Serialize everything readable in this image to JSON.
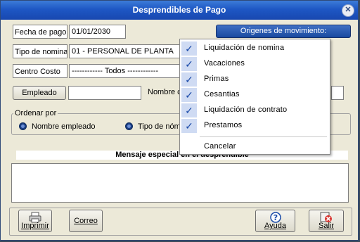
{
  "window": {
    "title": "Desprendibles de Pago",
    "close_glyph": "✕"
  },
  "form": {
    "fecha_label": "Fecha de pago",
    "fecha_value": "01/01/2030",
    "tipo_label": "Tipo de nomina",
    "tipo_value": "01 - PERSONAL DE PLANTA",
    "centro_label": "Centro Costo",
    "centro_value": "------------ Todos ------------",
    "empleado_button": "Empleado",
    "empleado_value": "",
    "nombre_label": "Nombre c",
    "origenes_button": "Origenes de movimiento:"
  },
  "ordenar": {
    "legend": "Ordenar por",
    "options": [
      "Nombre empleado",
      "Tipo de nóm"
    ]
  },
  "mensaje": {
    "label": "Mensaje especial en el desprendible",
    "value": ""
  },
  "footer": {
    "imprimir": "Imprimir",
    "correo": "Correo",
    "ayuda": "Ayuda",
    "salir": "Salir"
  },
  "menu": {
    "items": [
      {
        "label": "Liquidación de nomina",
        "checked": true
      },
      {
        "label": "Vacaciones",
        "checked": true
      },
      {
        "label": "Primas",
        "checked": true
      },
      {
        "label": "Cesantias",
        "checked": true
      },
      {
        "label": "Liquidación de contrato",
        "checked": true
      },
      {
        "label": "Prestamos",
        "checked": true
      }
    ],
    "cancel": "Cancelar",
    "check_glyph": "✓"
  },
  "colors": {
    "accent": "#1e57c4",
    "menu_check_bg": "#cfdbf3"
  }
}
